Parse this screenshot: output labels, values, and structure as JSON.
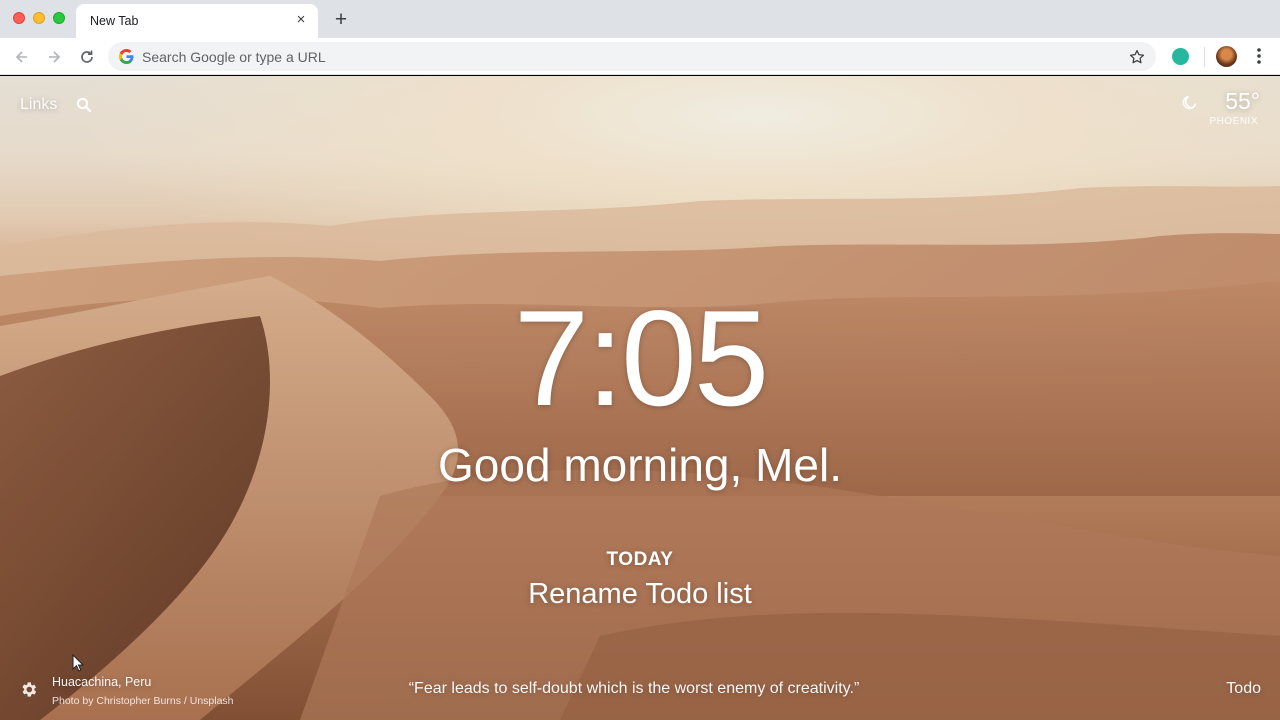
{
  "browser": {
    "tab_title": "New Tab",
    "tab_close": "×",
    "new_tab": "+",
    "omnibox_placeholder": "Search Google or type a URL"
  },
  "header": {
    "links_label": "Links",
    "weather": {
      "temperature": "55°",
      "city": "PHOENIX"
    }
  },
  "main": {
    "time": "7:05",
    "greeting": "Good morning, Mel.",
    "focus_label": "TODAY",
    "focus_text": "Rename Todo list"
  },
  "footer": {
    "location": "Huacachina, Peru",
    "photo_credit": "Photo by Christopher Burns / Unsplash",
    "quote": "“Fear leads to self-doubt which is the worst enemy of creativity.”",
    "todo_label": "Todo"
  },
  "colors": {
    "tabbar": "#dee1e6",
    "extension_accent": "#25b89e"
  },
  "icons": [
    "back-icon",
    "forward-icon",
    "reload-icon",
    "google-icon",
    "star-icon",
    "menu-icon",
    "search-icon",
    "moon-icon",
    "gear-icon",
    "cursor-icon"
  ]
}
